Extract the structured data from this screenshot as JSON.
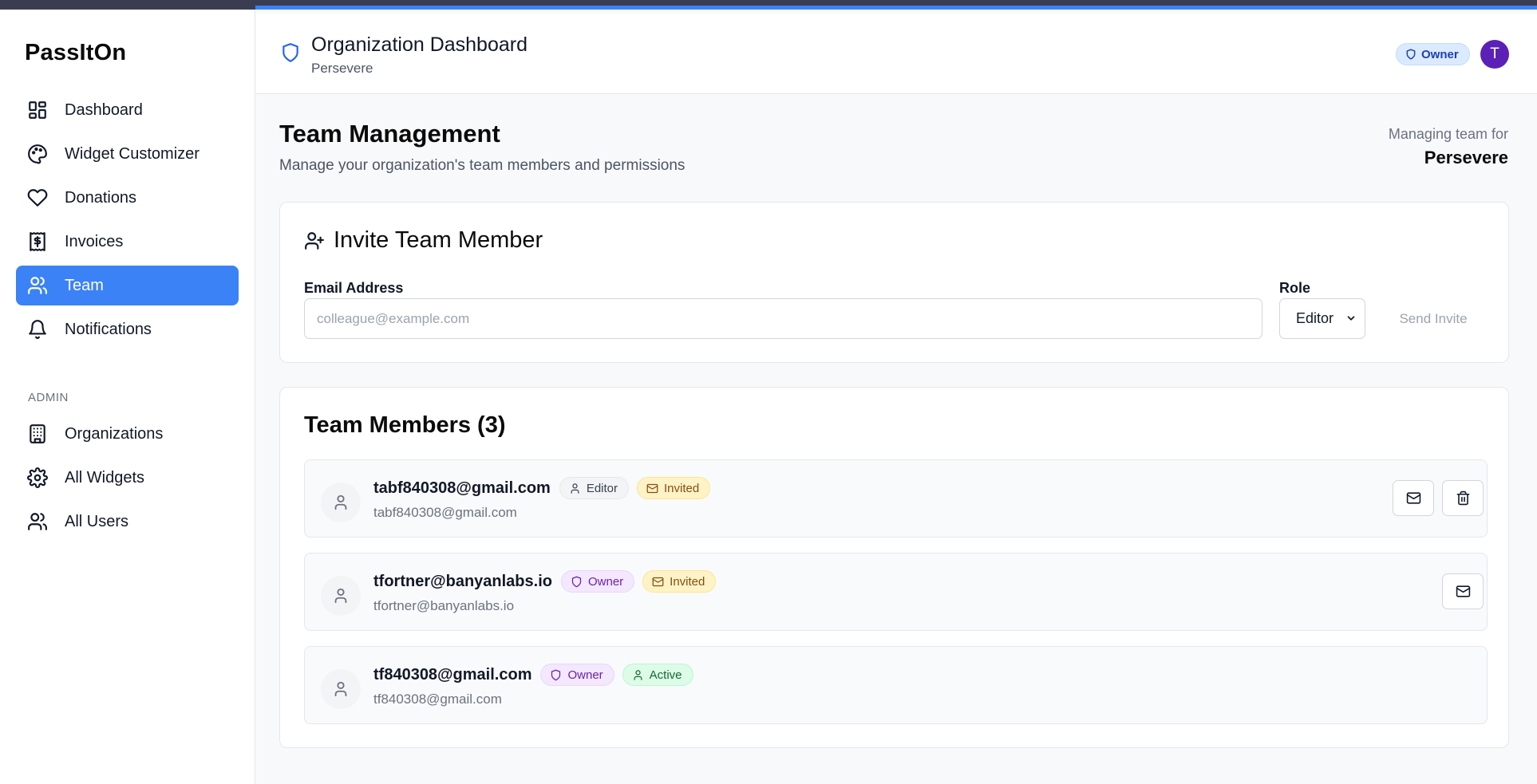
{
  "app": {
    "name": "PassItOn"
  },
  "sidebar": {
    "items": [
      {
        "label": "Dashboard",
        "icon": "dashboard-icon"
      },
      {
        "label": "Widget Customizer",
        "icon": "palette-icon"
      },
      {
        "label": "Donations",
        "icon": "heart-icon"
      },
      {
        "label": "Invoices",
        "icon": "receipt-icon"
      },
      {
        "label": "Team",
        "icon": "users-icon",
        "active": true
      },
      {
        "label": "Notifications",
        "icon": "bell-icon"
      }
    ],
    "admin_label": "ADMIN",
    "admin_items": [
      {
        "label": "Organizations",
        "icon": "building-icon"
      },
      {
        "label": "All Widgets",
        "icon": "gear-icon"
      },
      {
        "label": "All Users",
        "icon": "users-icon"
      }
    ]
  },
  "header": {
    "title": "Organization Dashboard",
    "subtitle": "Persevere",
    "role_badge": "Owner",
    "avatar_initial": "T"
  },
  "page": {
    "title": "Team Management",
    "subtitle": "Manage your organization's team members and permissions",
    "managing_label": "Managing team for",
    "managing_org": "Persevere"
  },
  "invite": {
    "title": "Invite Team Member",
    "email_label": "Email Address",
    "email_value": "",
    "email_placeholder": "colleague@example.com",
    "role_label": "Role",
    "role_value": "Editor",
    "send_label": "Send Invite"
  },
  "members": {
    "title": "Team Members (3)",
    "list": [
      {
        "name": "tabf840308@gmail.com",
        "email": "tabf840308@gmail.com",
        "role": "Editor",
        "status": "Invited"
      },
      {
        "name": "tfortner@banyanlabs.io",
        "email": "tfortner@banyanlabs.io",
        "role": "Owner",
        "status": "Invited"
      },
      {
        "name": "tf840308@gmail.com",
        "email": "tf840308@gmail.com",
        "role": "Owner",
        "status": "Active"
      }
    ]
  },
  "colors": {
    "accent": "#3b82f6",
    "owner_badge": "#f3e8ff",
    "invited_badge": "#fef3c7",
    "active_badge": "#dcfce7",
    "avatar": "#5b21b6"
  }
}
